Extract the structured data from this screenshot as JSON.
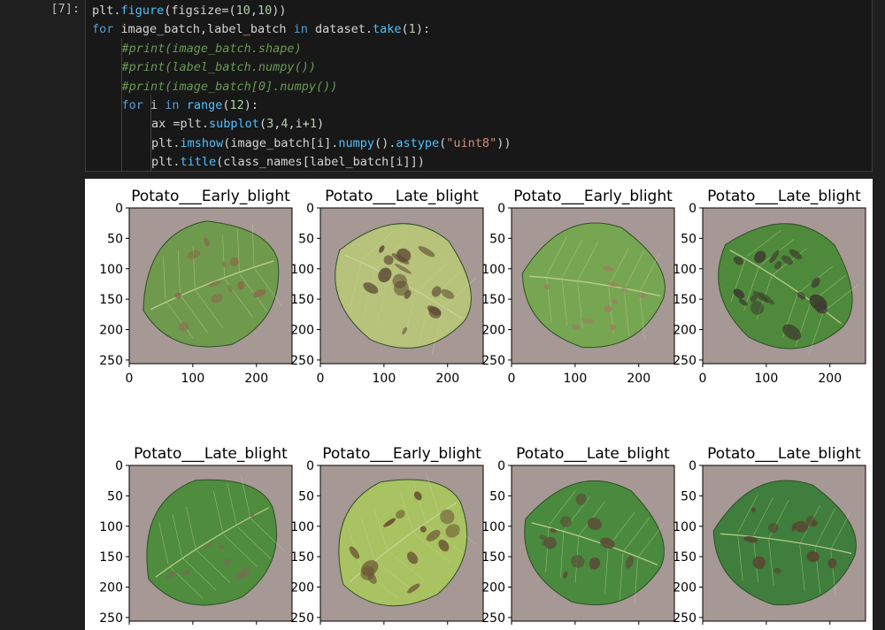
{
  "cell": {
    "prompt": "[7]:",
    "lines": [
      {
        "indent": 0,
        "tokens": [
          {
            "t": "plt.",
            "c": "plain"
          },
          {
            "t": "figure",
            "c": "func"
          },
          {
            "t": "(figsize=(",
            "c": "plain"
          },
          {
            "t": "10",
            "c": "num"
          },
          {
            "t": ",",
            "c": "plain"
          },
          {
            "t": "10",
            "c": "num"
          },
          {
            "t": "))",
            "c": "plain"
          }
        ]
      },
      {
        "indent": 0,
        "tokens": [
          {
            "t": "for",
            "c": "kw"
          },
          {
            "t": " image_batch,label_batch ",
            "c": "plain"
          },
          {
            "t": "in",
            "c": "kw"
          },
          {
            "t": " dataset.",
            "c": "plain"
          },
          {
            "t": "take",
            "c": "func"
          },
          {
            "t": "(",
            "c": "plain"
          },
          {
            "t": "1",
            "c": "num"
          },
          {
            "t": "):",
            "c": "plain"
          }
        ]
      },
      {
        "indent": 1,
        "tokens": [
          {
            "t": "#print(image_batch.shape)",
            "c": "comment"
          }
        ]
      },
      {
        "indent": 1,
        "tokens": [
          {
            "t": "#print(label_batch.numpy())",
            "c": "comment"
          }
        ]
      },
      {
        "indent": 1,
        "tokens": [
          {
            "t": "#print(image_batch[0].numpy())",
            "c": "comment"
          }
        ]
      },
      {
        "indent": 1,
        "tokens": [
          {
            "t": "for",
            "c": "kw"
          },
          {
            "t": " i ",
            "c": "plain"
          },
          {
            "t": "in",
            "c": "kw"
          },
          {
            "t": " ",
            "c": "plain"
          },
          {
            "t": "range",
            "c": "func"
          },
          {
            "t": "(",
            "c": "plain"
          },
          {
            "t": "12",
            "c": "num"
          },
          {
            "t": "):",
            "c": "plain"
          }
        ]
      },
      {
        "indent": 2,
        "tokens": [
          {
            "t": "ax =plt.",
            "c": "plain"
          },
          {
            "t": "subplot",
            "c": "func"
          },
          {
            "t": "(",
            "c": "plain"
          },
          {
            "t": "3",
            "c": "num"
          },
          {
            "t": ",",
            "c": "plain"
          },
          {
            "t": "4",
            "c": "num"
          },
          {
            "t": ",i+",
            "c": "plain"
          },
          {
            "t": "1",
            "c": "num"
          },
          {
            "t": ")",
            "c": "plain"
          }
        ]
      },
      {
        "indent": 2,
        "tokens": [
          {
            "t": "plt.",
            "c": "plain"
          },
          {
            "t": "imshow",
            "c": "func"
          },
          {
            "t": "(image_batch[i].",
            "c": "plain"
          },
          {
            "t": "numpy",
            "c": "func"
          },
          {
            "t": "().",
            "c": "plain"
          },
          {
            "t": "astype",
            "c": "func"
          },
          {
            "t": "(",
            "c": "plain"
          },
          {
            "t": "\"uint8\"",
            "c": "str"
          },
          {
            "t": "))",
            "c": "plain"
          }
        ]
      },
      {
        "indent": 2,
        "tokens": [
          {
            "t": "plt.",
            "c": "plain"
          },
          {
            "t": "title",
            "c": "func"
          },
          {
            "t": "(class_names[label_batch[i]])",
            "c": "plain"
          }
        ]
      }
    ]
  },
  "colors": {
    "plain": "#d4d4d4",
    "kw": "#569cd6",
    "func": "#4fc1ff",
    "num": "#b5cea8",
    "str": "#ce9178",
    "comment": "#6a9955"
  },
  "figure": {
    "x_ticks": [
      "0",
      "100",
      "200"
    ],
    "y_ticks": [
      "0",
      "50",
      "100",
      "150",
      "200",
      "250"
    ],
    "subplots": [
      {
        "title": "Potato___Early_blight",
        "leaf": {
          "color": "#6f9a4e",
          "spots": "#8a6b4a",
          "rot": -20,
          "severity": 0.25
        }
      },
      {
        "title": "Potato___Late_blight",
        "leaf": {
          "color": "#b7c27a",
          "spots": "#5d4a34",
          "rot": 30,
          "severity": 0.55
        }
      },
      {
        "title": "Potato___Early_blight",
        "leaf": {
          "color": "#77a653",
          "spots": "#9a8060",
          "rot": 10,
          "severity": 0.2
        }
      },
      {
        "title": "Potato___Late_blight",
        "leaf": {
          "color": "#4f8a3c",
          "spots": "#3d3a2e",
          "rot": 35,
          "severity": 0.6
        }
      },
      {
        "title": "Potato___Late_blight",
        "leaf": {
          "color": "#4f8c3e",
          "spots": "#7a6a55",
          "rot": -30,
          "severity": 0.1
        }
      },
      {
        "title": "Potato___Early_blight",
        "leaf": {
          "color": "#a9c262",
          "spots": "#6b5233",
          "rot": -35,
          "severity": 0.5
        }
      },
      {
        "title": "Potato___Late_blight",
        "leaf": {
          "color": "#4a8a3e",
          "spots": "#5a4a38",
          "rot": 20,
          "severity": 0.35
        }
      },
      {
        "title": "Potato___Late_blight",
        "leaf": {
          "color": "#3f7e3c",
          "spots": "#5a4230",
          "rot": 10,
          "severity": 0.3
        }
      }
    ]
  }
}
